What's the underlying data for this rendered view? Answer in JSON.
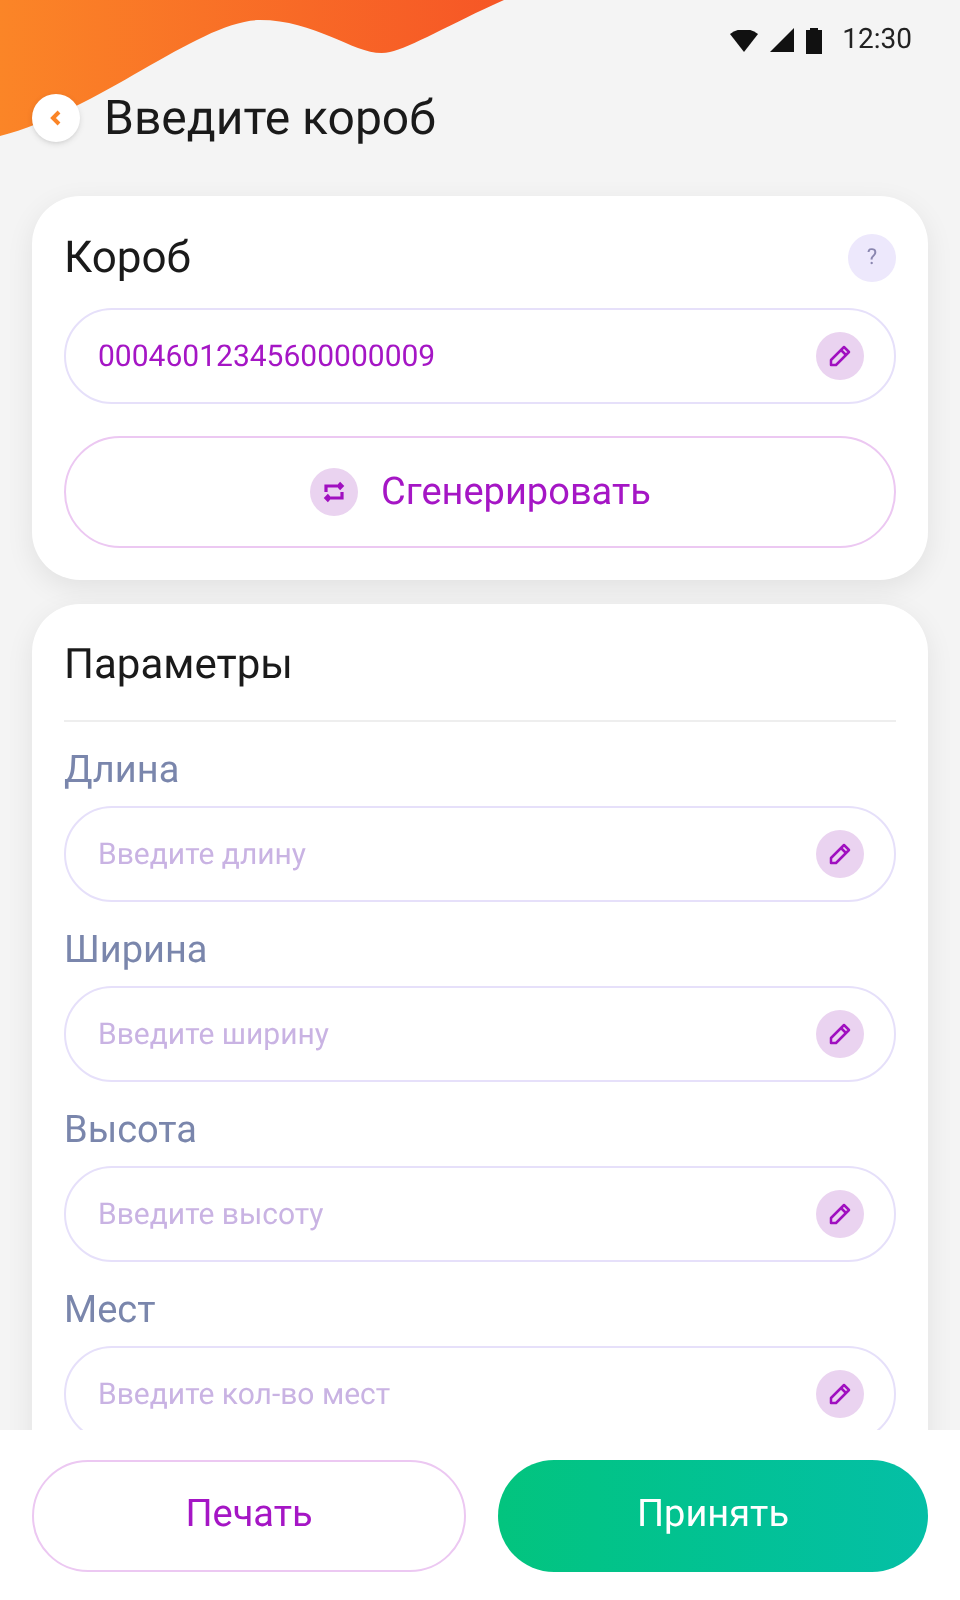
{
  "status_bar": {
    "time": "12:30"
  },
  "header": {
    "title": "Введите короб"
  },
  "box_card": {
    "title": "Короб",
    "help": "?",
    "value": "00046012345600000009",
    "generate_button": "Сгенерировать"
  },
  "params_card": {
    "title": "Параметры",
    "fields": [
      {
        "label": "Длина",
        "placeholder": "Введите длину"
      },
      {
        "label": "Ширина",
        "placeholder": "Введите ширину"
      },
      {
        "label": "Высота",
        "placeholder": "Введите высоту"
      },
      {
        "label": "Мест",
        "placeholder": "Введите кол-во мест"
      }
    ]
  },
  "buttons": {
    "print": "Печать",
    "accept": "Принять"
  }
}
